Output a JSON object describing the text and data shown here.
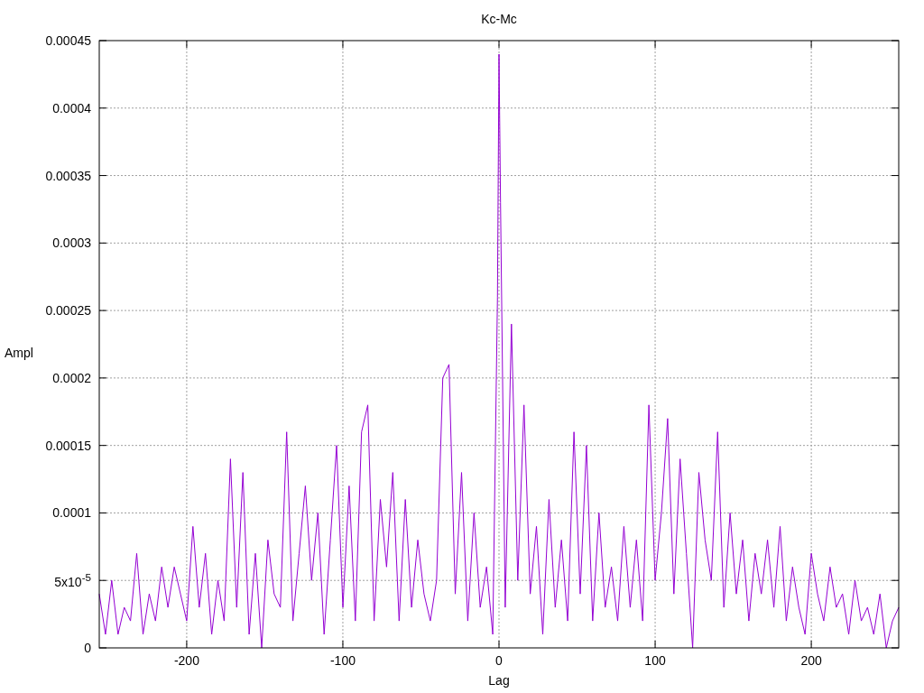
{
  "chart_data": {
    "type": "line",
    "grid": true,
    "title": "Kc-Mc",
    "xlabel": "Lag",
    "ylabel": "Ampl",
    "xlim": [
      -256,
      256
    ],
    "ylim": [
      0,
      0.00045
    ],
    "xticks": [
      -200,
      -100,
      0,
      100,
      200
    ],
    "yticks": [
      {
        "value": 0,
        "label": "0"
      },
      {
        "value": 5e-05,
        "label": "5x10$^{-5}$"
      },
      {
        "value": 0.0001,
        "label": "0.0001"
      },
      {
        "value": 0.00015,
        "label": "0.00015"
      },
      {
        "value": 0.0002,
        "label": "0.0002"
      },
      {
        "value": 0.00025,
        "label": "0.00025"
      },
      {
        "value": 0.0003,
        "label": "0.0003"
      },
      {
        "value": 0.00035,
        "label": "0.00035"
      },
      {
        "value": 0.0004,
        "label": "0.0004"
      },
      {
        "value": 0.00045,
        "label": "0.00045"
      }
    ],
    "x": [
      -256,
      -252,
      -248,
      -244,
      -240,
      -236,
      -232,
      -228,
      -224,
      -220,
      -216,
      -212,
      -208,
      -204,
      -200,
      -196,
      -192,
      -188,
      -184,
      -180,
      -176,
      -172,
      -168,
      -164,
      -160,
      -156,
      -152,
      -148,
      -144,
      -140,
      -136,
      -132,
      -128,
      -124,
      -120,
      -116,
      -112,
      -108,
      -104,
      -100,
      -96,
      -92,
      -88,
      -84,
      -80,
      -76,
      -72,
      -68,
      -64,
      -60,
      -56,
      -52,
      -48,
      -44,
      -40,
      -36,
      -32,
      -28,
      -24,
      -20,
      -16,
      -12,
      -8,
      -4,
      -1,
      0,
      1,
      4,
      8,
      12,
      16,
      20,
      24,
      28,
      32,
      36,
      40,
      44,
      48,
      52,
      56,
      60,
      64,
      68,
      72,
      76,
      80,
      84,
      88,
      92,
      96,
      100,
      104,
      108,
      112,
      116,
      120,
      124,
      128,
      132,
      136,
      140,
      144,
      148,
      152,
      156,
      160,
      164,
      168,
      172,
      176,
      180,
      184,
      188,
      192,
      196,
      200,
      204,
      208,
      212,
      216,
      220,
      224,
      228,
      232,
      236,
      240,
      244,
      248,
      252,
      256
    ],
    "series": [
      {
        "color": "#9400d3",
        "values": [
          4e-05,
          1e-05,
          5e-05,
          1e-05,
          3e-05,
          2e-05,
          7e-05,
          1e-05,
          4e-05,
          2e-05,
          6e-05,
          3e-05,
          6e-05,
          4e-05,
          2e-05,
          9e-05,
          3e-05,
          7e-05,
          1e-05,
          5e-05,
          2e-05,
          0.00014,
          3e-05,
          0.00013,
          1e-05,
          7e-05,
          0,
          8e-05,
          4e-05,
          3e-05,
          0.00016,
          2e-05,
          7e-05,
          0.00012,
          5e-05,
          0.0001,
          1e-05,
          8e-05,
          0.00015,
          3e-05,
          0.00012,
          2e-05,
          0.00016,
          0.00018,
          2e-05,
          0.00011,
          6e-05,
          0.00013,
          2e-05,
          0.00011,
          3e-05,
          8e-05,
          4e-05,
          2e-05,
          5e-05,
          0.0002,
          0.00021,
          4e-05,
          0.00013,
          2e-05,
          0.0001,
          3e-05,
          6e-05,
          1e-05,
          0.00026,
          0.00044,
          0.00033,
          3e-05,
          0.00024,
          5e-05,
          0.00018,
          4e-05,
          9e-05,
          1e-05,
          0.00011,
          3e-05,
          8e-05,
          2e-05,
          0.00016,
          4e-05,
          0.00015,
          2e-05,
          0.0001,
          3e-05,
          6e-05,
          2e-05,
          9e-05,
          3e-05,
          8e-05,
          2e-05,
          0.00018,
          5e-05,
          0.0001,
          0.00017,
          4e-05,
          0.00014,
          7e-05,
          0,
          0.00013,
          8e-05,
          5e-05,
          0.00016,
          3e-05,
          0.0001,
          4e-05,
          8e-05,
          2e-05,
          7e-05,
          4e-05,
          8e-05,
          3e-05,
          9e-05,
          2e-05,
          6e-05,
          3e-05,
          1e-05,
          7e-05,
          4e-05,
          2e-05,
          6e-05,
          3e-05,
          4e-05,
          1e-05,
          5e-05,
          2e-05,
          3e-05,
          1e-05,
          4e-05,
          0,
          2e-05,
          3e-05
        ]
      }
    ]
  }
}
